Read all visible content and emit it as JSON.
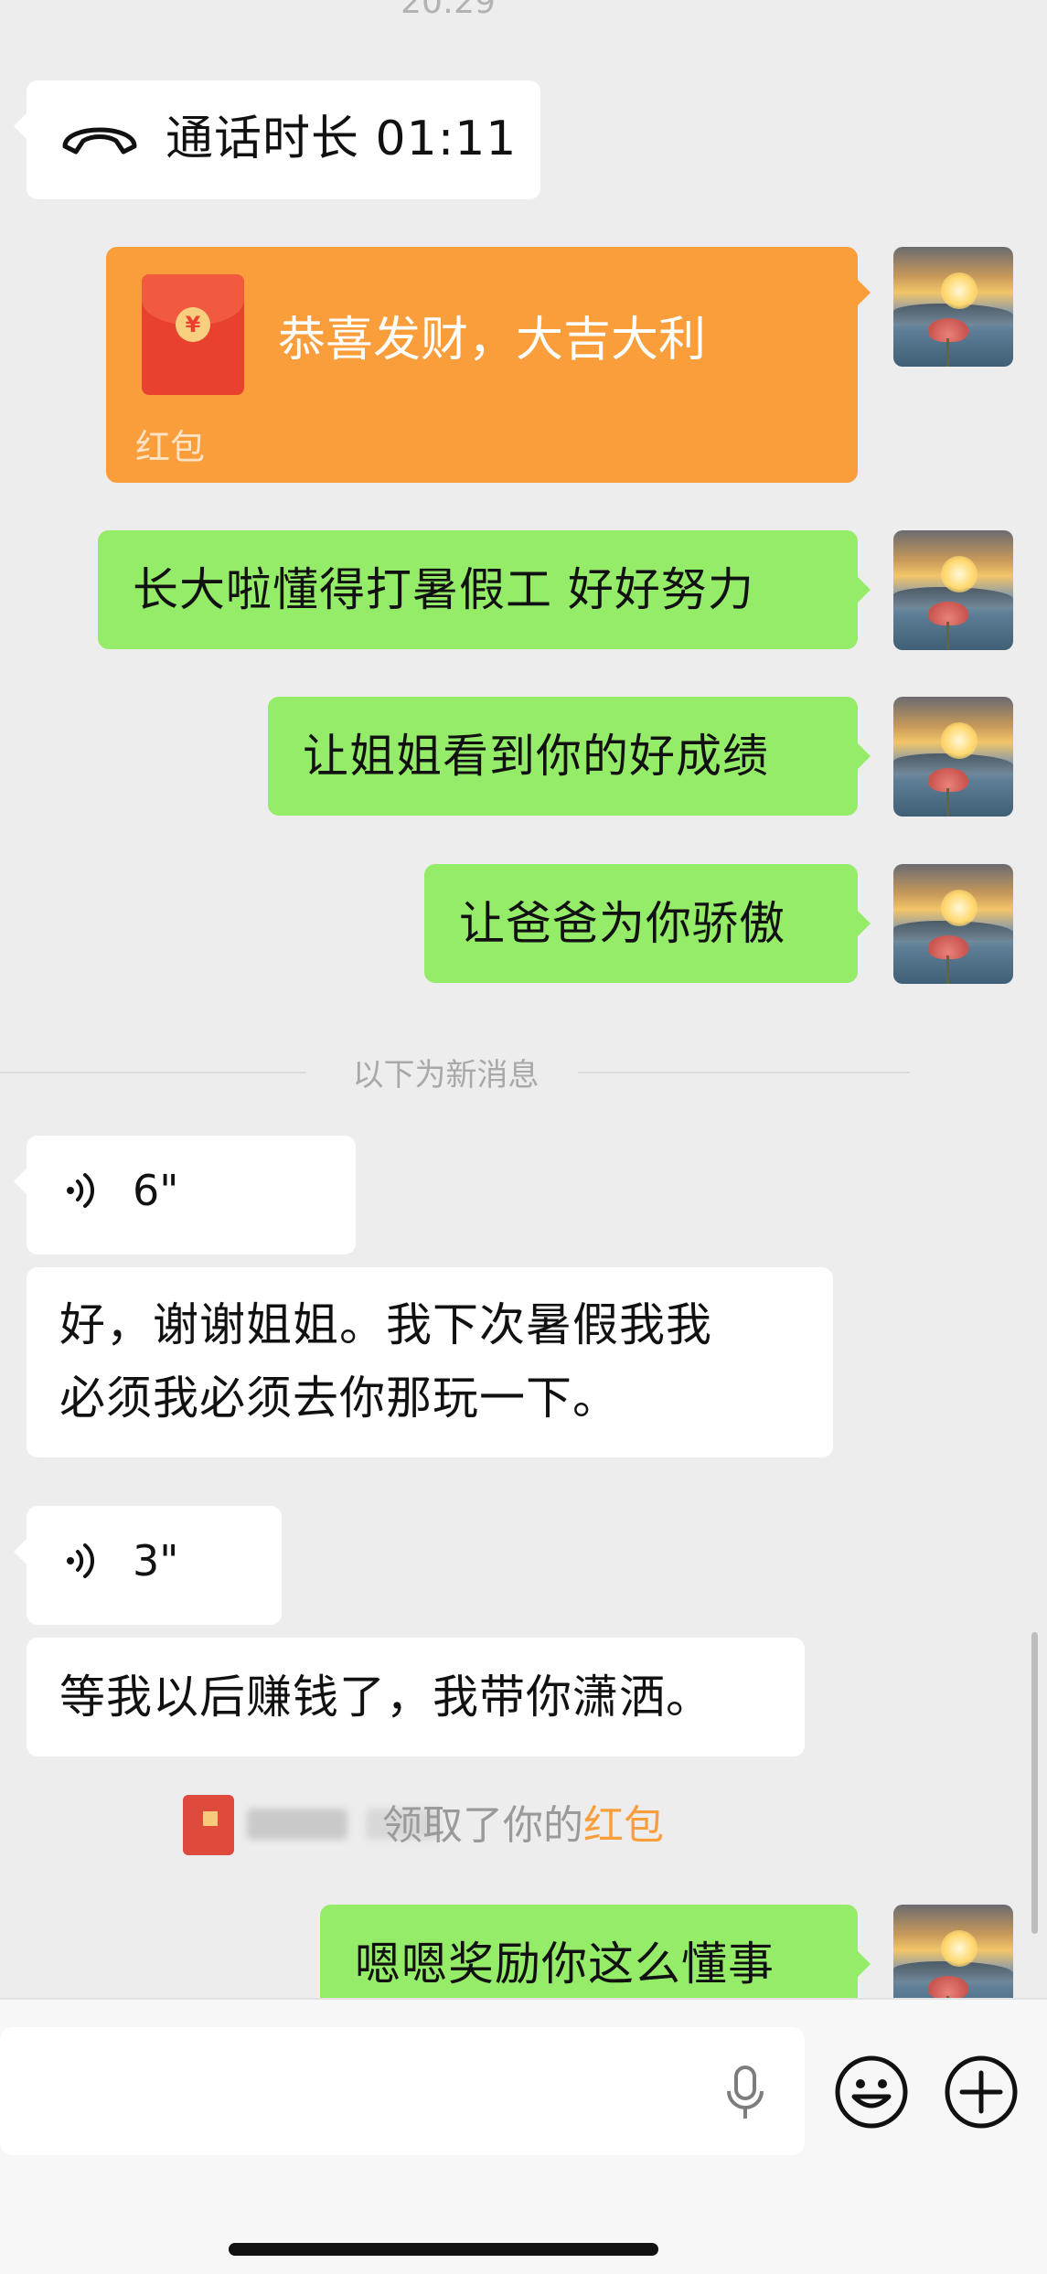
{
  "timestamp": "20:29",
  "call": {
    "text": "通话时长 01:11"
  },
  "red_packet": {
    "greeting": "恭喜发财，大吉大利",
    "label": "红包"
  },
  "sent_messages": [
    "长大啦懂得打暑假工 好好努力",
    "让姐姐看到你的好成绩",
    "让爸爸为你骄傲"
  ],
  "new_messages_divider": "以下为新消息",
  "voice_1": {
    "duration": "6\""
  },
  "received_1": {
    "line1": "好，谢谢姐姐。我下次暑假我我",
    "line2": "必须我必须去你那玩一下。"
  },
  "voice_2": {
    "duration": "3\""
  },
  "received_2": "等我以后赚钱了，我带你潇洒。",
  "redpacket_notice": {
    "text": "领取了你的",
    "link": "红包"
  },
  "last_sent": "嗯嗯奖励你这么懂事",
  "input": {
    "value": "",
    "placeholder": ""
  },
  "colors": {
    "bg": "#ededed",
    "green": "#95ec69",
    "orange": "#fa9d3b",
    "white": "#ffffff",
    "accent_link": "#fa9d3b"
  },
  "icons": [
    "phone-hangup-icon",
    "red-packet-icon",
    "voice-wave-icon",
    "microphone-icon",
    "emoji-icon",
    "plus-icon"
  ]
}
